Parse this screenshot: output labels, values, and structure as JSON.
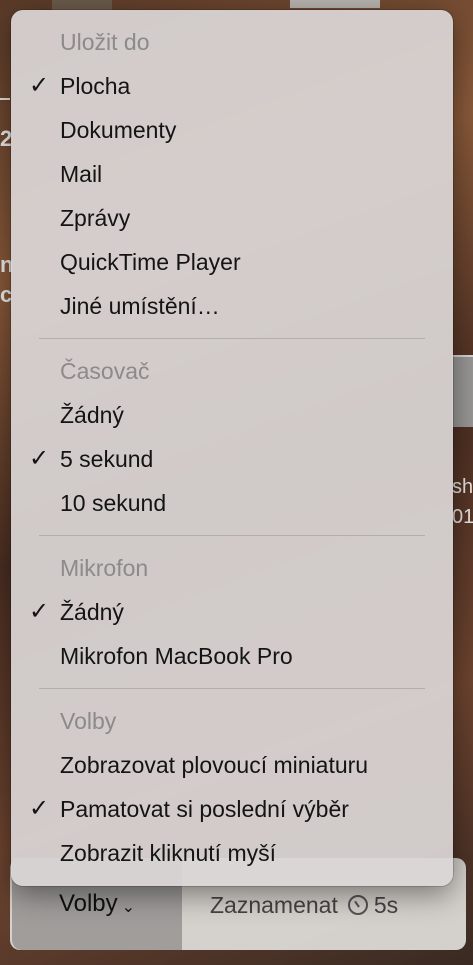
{
  "menu": {
    "sections": [
      {
        "header": "Uložit do",
        "items": [
          {
            "label": "Plocha",
            "checked": true
          },
          {
            "label": "Dokumenty",
            "checked": false
          },
          {
            "label": "Mail",
            "checked": false
          },
          {
            "label": "Zprávy",
            "checked": false
          },
          {
            "label": "QuickTime Player",
            "checked": false
          },
          {
            "label": "Jiné umístění…",
            "checked": false
          }
        ]
      },
      {
        "header": "Časovač",
        "items": [
          {
            "label": "Žádný",
            "checked": false
          },
          {
            "label": "5 sekund",
            "checked": true
          },
          {
            "label": "10 sekund",
            "checked": false
          }
        ]
      },
      {
        "header": "Mikrofon",
        "items": [
          {
            "label": "Žádný",
            "checked": true
          },
          {
            "label": "Mikrofon MacBook Pro",
            "checked": false
          }
        ]
      },
      {
        "header": "Volby",
        "items": [
          {
            "label": "Zobrazovat plovoucí miniaturu",
            "checked": false
          },
          {
            "label": "Pamatovat si poslední výběr",
            "checked": true
          },
          {
            "label": "Zobrazit kliknutí myší",
            "checked": false
          }
        ]
      }
    ]
  },
  "toolbar": {
    "options_label": "Volby",
    "record_label": "Zaznamenat",
    "timer_value": "5s"
  },
  "background": {
    "left_chars": [
      "2",
      "n",
      "c"
    ],
    "right_chars": [
      "sh",
      "01"
    ]
  },
  "icons": {
    "check": "✓",
    "chevron": "⌄"
  }
}
